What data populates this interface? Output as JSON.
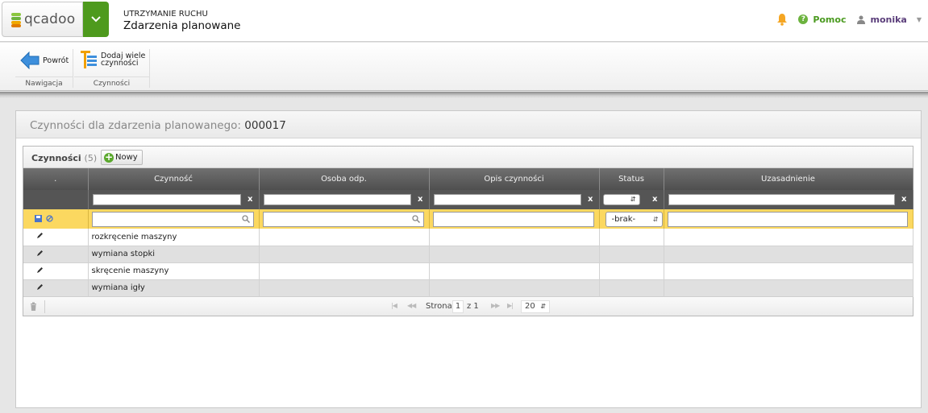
{
  "header": {
    "logo_text": "qcadoo",
    "section": "UTRZYMANIE RUCHU",
    "title": "Zdarzenia planowane",
    "help_label": "Pomoc",
    "help_glyph": "?",
    "user_name": "monika",
    "accent_green": "#4e9a1d"
  },
  "ribbon": {
    "groups": [
      {
        "label": "Nawigacja",
        "button": "Powrót"
      },
      {
        "label": "Czynności",
        "button_line1": "Dodaj wiele",
        "button_line2": "czynności"
      }
    ]
  },
  "window": {
    "title_prefix": "Czynności dla zdarzenia planowanego:",
    "title_number": "000017"
  },
  "grid": {
    "title": "Czynności",
    "count": "(5)",
    "new_button": "Nowy",
    "columns": [
      ".",
      "Czynność",
      "Osoba odp.",
      "Opis czynności",
      "Status",
      "Uzasadnienie"
    ],
    "filter_clear": "x",
    "new_row_status": "-brak-",
    "rows": [
      {
        "activity": "rozkręcenie maszyny",
        "person": "",
        "description": "",
        "status": "",
        "reason": ""
      },
      {
        "activity": "wymiana stopki",
        "person": "",
        "description": "",
        "status": "",
        "reason": ""
      },
      {
        "activity": "skręcenie maszyny",
        "person": "",
        "description": "",
        "status": "",
        "reason": ""
      },
      {
        "activity": "wymiana igły",
        "person": "",
        "description": "",
        "status": "",
        "reason": ""
      }
    ],
    "pager": {
      "page_label": "Strona",
      "page": "1",
      "of_label": "z 1",
      "page_size": "20"
    }
  }
}
